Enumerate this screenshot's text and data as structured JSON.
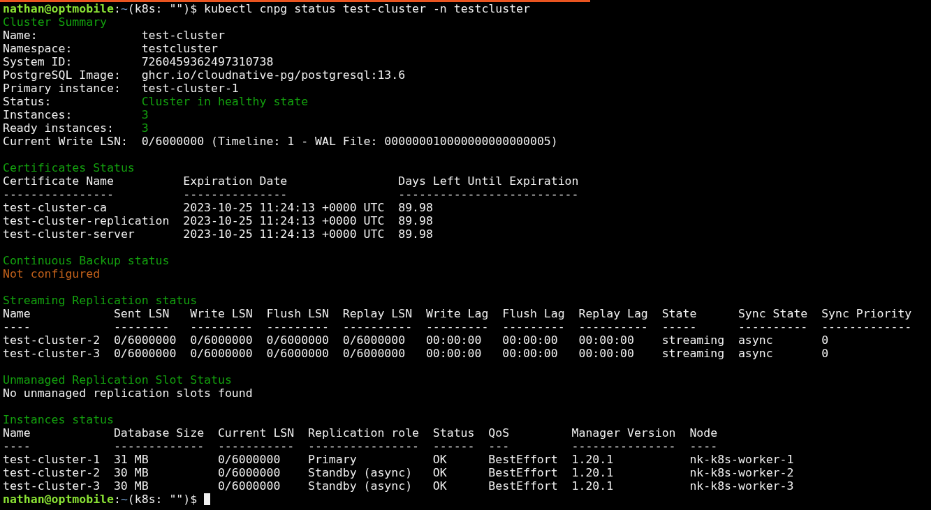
{
  "prompt": {
    "user": "nathan@optmobile",
    "separator": ":",
    "path": "~",
    "suffix": "(k8s: \"\")$",
    "command": "kubectl cnpg status test-cluster -n testcluster"
  },
  "sections": [
    {
      "kind": "summary",
      "title": "Cluster Summary",
      "rows": [
        {
          "key": "Name:",
          "value": "test-cluster"
        },
        {
          "key": "Namespace:",
          "value": "testcluster"
        },
        {
          "key": "System ID:",
          "value": "7260459362497310738"
        },
        {
          "key": "PostgreSQL Image:",
          "value": "ghcr.io/cloudnative-pg/postgresql:13.6"
        },
        {
          "key": "Primary instance:",
          "value": "test-cluster-1"
        },
        {
          "key": "Status:",
          "value": "Cluster in healthy state",
          "color": "#13a10e"
        },
        {
          "key": "Instances:",
          "value": "3",
          "color": "#13a10e"
        },
        {
          "key": "Ready instances:",
          "value": "3",
          "color": "#13a10e"
        },
        {
          "key": "Current Write LSN:",
          "value": "0/6000000 (Timeline: 1 - WAL File: 000000010000000000000005)"
        }
      ]
    },
    {
      "kind": "table",
      "title": "Certificates Status",
      "columns": [
        "Certificate Name",
        "Expiration Date",
        "Days Left Until Expiration"
      ],
      "rules": [
        "----------------",
        "---------------",
        "--------------------------"
      ],
      "rows": [
        [
          "test-cluster-ca",
          "2023-10-25 11:24:13 +0000 UTC",
          "89.98"
        ],
        [
          "test-cluster-replication",
          "2023-10-25 11:24:13 +0000 UTC",
          "89.98"
        ],
        [
          "test-cluster-server",
          "2023-10-25 11:24:13 +0000 UTC",
          "89.98"
        ]
      ]
    },
    {
      "kind": "text",
      "title": "Continuous Backup status",
      "text": "Not configured",
      "color": "#c4621b"
    },
    {
      "kind": "table",
      "title": "Streaming Replication status",
      "columns": [
        "Name",
        "Sent LSN",
        "Write LSN",
        "Flush LSN",
        "Replay LSN",
        "Write Lag",
        "Flush Lag",
        "Replay Lag",
        "State",
        "Sync State",
        "Sync Priority"
      ],
      "rules": [
        "----",
        "--------",
        "---------",
        "---------",
        "----------",
        "---------",
        "---------",
        "----------",
        "-----",
        "----------",
        "-------------"
      ],
      "rows": [
        [
          "test-cluster-2",
          "0/6000000",
          "0/6000000",
          "0/6000000",
          "0/6000000",
          "00:00:00",
          "00:00:00",
          "00:00:00",
          "streaming",
          "async",
          "0"
        ],
        [
          "test-cluster-3",
          "0/6000000",
          "0/6000000",
          "0/6000000",
          "0/6000000",
          "00:00:00",
          "00:00:00",
          "00:00:00",
          "streaming",
          "async",
          "0"
        ]
      ]
    },
    {
      "kind": "text",
      "title": "Unmanaged Replication Slot Status",
      "text": "No unmanaged replication slots found"
    },
    {
      "kind": "table",
      "title": "Instances status",
      "columns": [
        "Name",
        "Database Size",
        "Current LSN",
        "Replication role",
        "Status",
        "QoS",
        "Manager Version",
        "Node"
      ],
      "rules": [
        "----",
        "-------------",
        "-----------",
        "----------------",
        "------",
        "---",
        "---------------",
        "----"
      ],
      "rows": [
        [
          "test-cluster-1",
          "31 MB",
          "0/6000000",
          "Primary",
          "OK",
          "BestEffort",
          "1.20.1",
          "nk-k8s-worker-1"
        ],
        [
          "test-cluster-2",
          "30 MB",
          "0/6000000",
          "Standby (async)",
          "OK",
          "BestEffort",
          "1.20.1",
          "nk-k8s-worker-2"
        ],
        [
          "test-cluster-3",
          "30 MB",
          "0/6000000",
          "Standby (async)",
          "OK",
          "BestEffort",
          "1.20.1",
          "nk-k8s-worker-3"
        ]
      ]
    }
  ],
  "final_prompt": {
    "user": "nathan@optmobile",
    "separator": ":",
    "path": "~",
    "suffix": "(k8s: \"\")$"
  }
}
